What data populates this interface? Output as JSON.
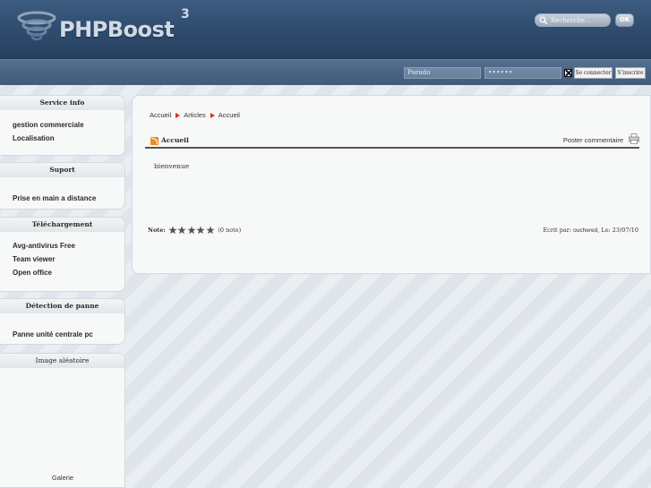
{
  "header": {
    "logo_text": "PHPBoost",
    "logo_version": "3",
    "search_placeholder": "Recherche...",
    "search_button": "OK"
  },
  "login": {
    "pseudo_placeholder": "Pseudo",
    "password_value": "••••••",
    "login_button": "Se connecter",
    "register_button": "S'inscrire"
  },
  "sidebar": {
    "service_info": {
      "title": "Service info",
      "items": [
        "gestion commerciale",
        "Localisation"
      ]
    },
    "suport": {
      "title": "Suport",
      "items": [
        "Prise en main a distance"
      ]
    },
    "telechargement": {
      "title": "Téléchargement",
      "items": [
        "Avg-antivirus Free",
        "Team viewer",
        "Open office"
      ]
    },
    "detection": {
      "title": "Détection de panne",
      "items": [
        "Panne unité centrale pc"
      ]
    },
    "image": {
      "title": "Image aléatoire",
      "footer": "Galerie"
    }
  },
  "main": {
    "breadcrumb": [
      "Accueil",
      "Articles",
      "Accueil"
    ],
    "article_title": "Accueil",
    "post_comment": "Poster commentaire",
    "content": "bienvenue",
    "note_label": "Note:",
    "note_count": "(0 note)",
    "written_prefix": "Ecrit par:",
    "author": "ouchered",
    "date_text": ", Le: 23/07/10"
  },
  "colors": {
    "header_bg": "#2e4b6d",
    "topbar_bg": "#4a6384",
    "breadcrumb_arrow": "#d8331e",
    "rss": "#f28a1d"
  }
}
